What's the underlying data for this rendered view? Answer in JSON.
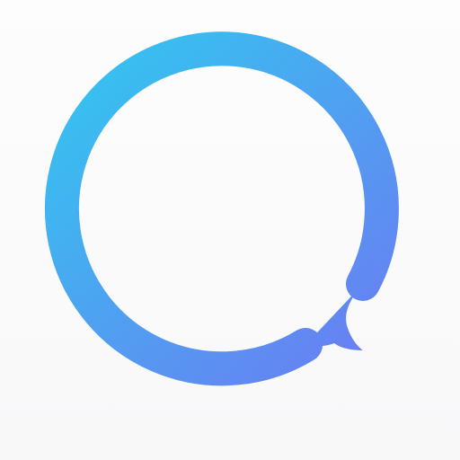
{
  "icon": {
    "name": "circle-speech-bubble-logo",
    "background_color": "#f8f8f9",
    "gradient_start": "#35c3f0",
    "gradient_end": "#6e78f2"
  }
}
